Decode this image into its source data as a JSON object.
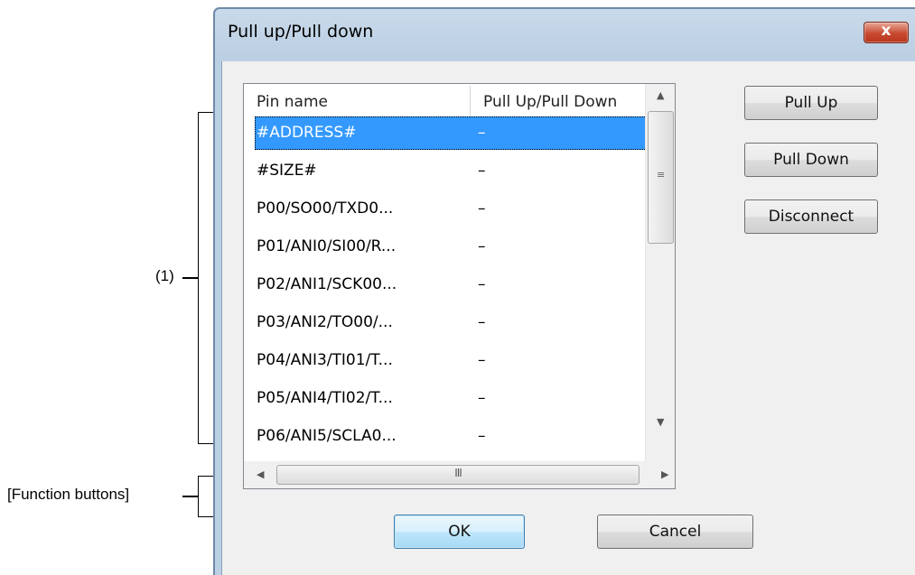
{
  "annotations": {
    "list_label": "(1)",
    "buttons_label": "[Function buttons]"
  },
  "dialog": {
    "title": "Pull up/Pull down",
    "close_label": "x"
  },
  "list": {
    "columns": [
      "Pin name",
      "Pull Up/Pull Down"
    ],
    "rows": [
      {
        "pin": "#ADDRESS#",
        "value": "–",
        "selected": true
      },
      {
        "pin": "#SIZE#",
        "value": "–"
      },
      {
        "pin": "P00/SO00/TXD0...",
        "value": "–"
      },
      {
        "pin": "P01/ANI0/SI00/R...",
        "value": "–"
      },
      {
        "pin": "P02/ANI1/SCK00...",
        "value": "–"
      },
      {
        "pin": "P03/ANI2/TO00/...",
        "value": "–"
      },
      {
        "pin": "P04/ANI3/TI01/T...",
        "value": "–"
      },
      {
        "pin": "P05/ANI4/TI02/T...",
        "value": "–"
      },
      {
        "pin": "P06/ANI5/SCLA0...",
        "value": "–"
      }
    ],
    "vscroll_grip": "≡",
    "hscroll_grip": "III"
  },
  "side_buttons": {
    "pull_up": "Pull Up",
    "pull_down": "Pull Down",
    "disconnect": "Disconnect"
  },
  "footer": {
    "ok": "OK",
    "cancel": "Cancel"
  }
}
